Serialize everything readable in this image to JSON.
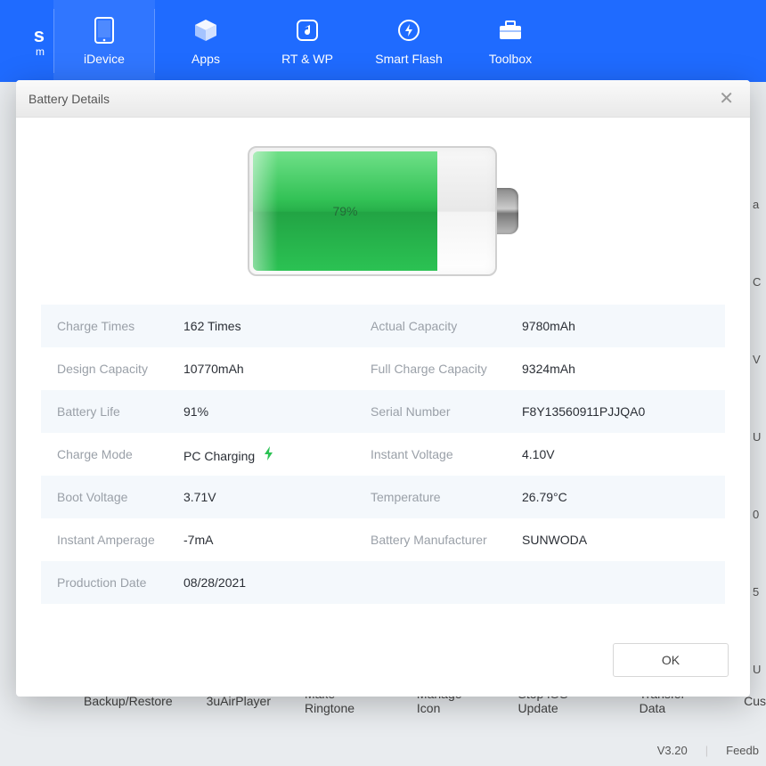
{
  "logo_suffix": "s",
  "logo_sub": "m",
  "nav": [
    {
      "label": "iDevice"
    },
    {
      "label": "Apps"
    },
    {
      "label": "RT & WP"
    },
    {
      "label": "Smart Flash"
    },
    {
      "label": "Toolbox"
    }
  ],
  "modal": {
    "title": "Battery Details",
    "percent_label": "79%",
    "ok_label": "OK",
    "rows": {
      "charge_times_label": "Charge Times",
      "charge_times_value": "162 Times",
      "actual_capacity_label": "Actual Capacity",
      "actual_capacity_value": "9780mAh",
      "design_capacity_label": "Design Capacity",
      "design_capacity_value": "10770mAh",
      "full_charge_label": "Full Charge Capacity",
      "full_charge_value": "9324mAh",
      "battery_life_label": "Battery Life",
      "battery_life_value": "91%",
      "serial_label": "Serial Number",
      "serial_value": "F8Y13560911PJJQA0",
      "charge_mode_label": "Charge Mode",
      "charge_mode_value": "PC Charging",
      "instant_voltage_label": "Instant Voltage",
      "instant_voltage_value": "4.10V",
      "boot_voltage_label": "Boot Voltage",
      "boot_voltage_value": "3.71V",
      "temperature_label": "Temperature",
      "temperature_value": "26.79°C",
      "instant_amp_label": "Instant Amperage",
      "instant_amp_value": "-7mA",
      "manufacturer_label": "Battery Manufacturer",
      "manufacturer_value": "SUNWODA",
      "production_label": "Production Date",
      "production_value": "08/28/2021"
    }
  },
  "bottom_links": [
    "Backup/Restore",
    "3uAirPlayer",
    "Make Ringtone",
    "Manage Icon",
    "Stop iOS Update",
    "Transfer Data",
    "Cus"
  ],
  "status": {
    "version": "V3.20",
    "feedback": "Feedb"
  },
  "side_peek": [
    "a",
    "C",
    "V",
    "U",
    "0",
    "5",
    "U"
  ]
}
